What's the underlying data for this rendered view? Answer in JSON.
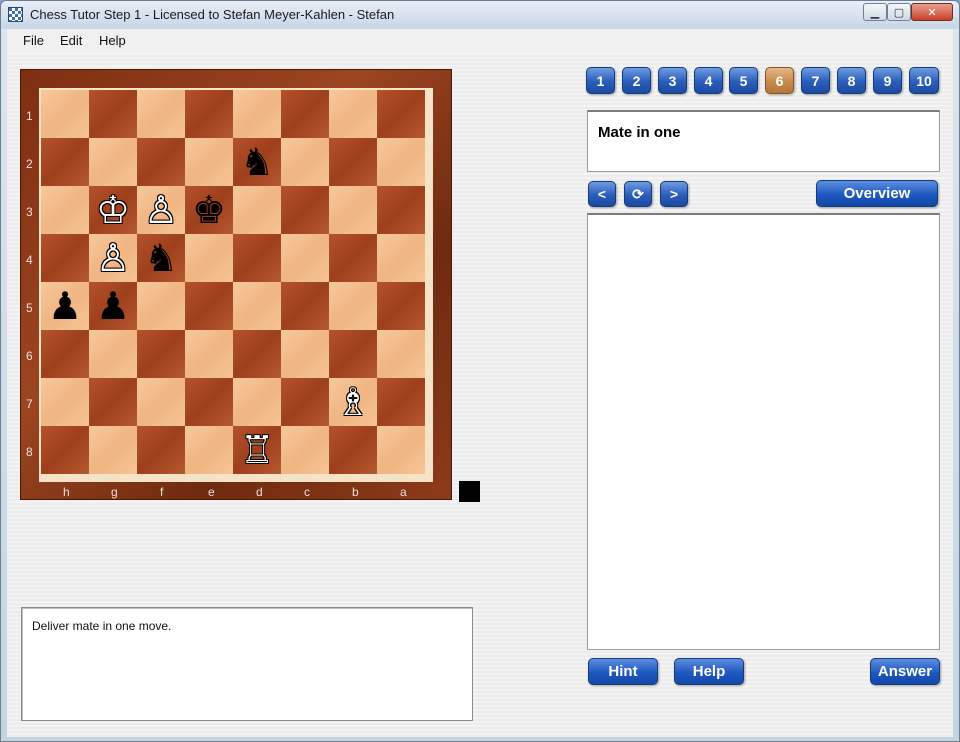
{
  "window": {
    "title": "Chess Tutor Step 1 - Licensed to Stefan Meyer-Kahlen - Stefan",
    "minimize_glyph": "▁",
    "maximize_glyph": "▢",
    "close_glyph": "✕",
    "app_icon": "chessboard-icon"
  },
  "menu": {
    "items": [
      {
        "label": "File"
      },
      {
        "label": "Edit"
      },
      {
        "label": "Help"
      }
    ]
  },
  "board": {
    "orientation": "flipped",
    "rank_labels": [
      "1",
      "2",
      "3",
      "4",
      "5",
      "6",
      "7",
      "8"
    ],
    "file_labels": [
      "h",
      "g",
      "f",
      "e",
      "d",
      "c",
      "b",
      "a"
    ],
    "light_color": "#f2b987",
    "dark_color": "#a7451f",
    "side_to_move_color": "#000000",
    "pieces": [
      {
        "square": "d2",
        "color": "black",
        "type": "knight",
        "glyph": "♞"
      },
      {
        "square": "g3",
        "color": "white",
        "type": "king",
        "glyph": "♔"
      },
      {
        "square": "f3",
        "color": "white",
        "type": "pawn",
        "glyph": "♙"
      },
      {
        "square": "e3",
        "color": "black",
        "type": "king",
        "glyph": "♚"
      },
      {
        "square": "g4",
        "color": "white",
        "type": "pawn",
        "glyph": "♙"
      },
      {
        "square": "f4",
        "color": "black",
        "type": "knight",
        "glyph": "♞"
      },
      {
        "square": "h5",
        "color": "black",
        "type": "pawn",
        "glyph": "♟"
      },
      {
        "square": "g5",
        "color": "black",
        "type": "pawn",
        "glyph": "♟"
      },
      {
        "square": "b7",
        "color": "white",
        "type": "bishop",
        "glyph": "♗"
      },
      {
        "square": "d8",
        "color": "white",
        "type": "rook",
        "glyph": "♖"
      }
    ]
  },
  "comment": {
    "text": "Deliver mate in one move."
  },
  "exercises": {
    "selected": "6",
    "active_color": "#c88a4c",
    "items": [
      "1",
      "2",
      "3",
      "4",
      "5",
      "6",
      "7",
      "8",
      "9",
      "10"
    ]
  },
  "exercise_panel": {
    "title": "Mate in one"
  },
  "nav": {
    "prev_label": "<",
    "reset_label": "⟳",
    "next_label": ">",
    "overview_label": "Overview"
  },
  "bottom": {
    "hint_label": "Hint",
    "help_label": "Help",
    "answer_label": "Answer"
  }
}
